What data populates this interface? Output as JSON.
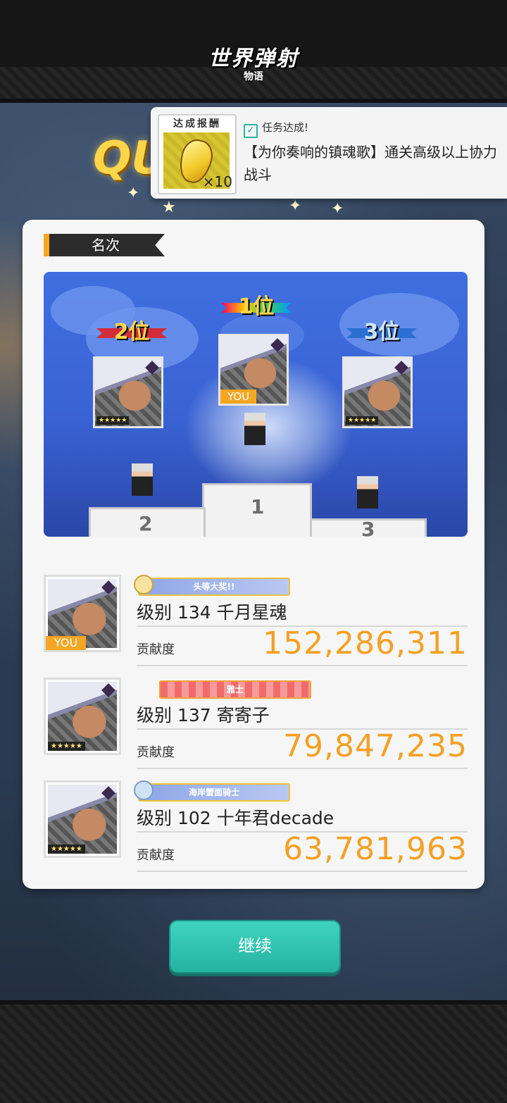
{
  "game": {
    "logo": {
      "main": "世界弹射",
      "sub": "物语"
    },
    "quest_banner_text": "QU"
  },
  "toast": {
    "reward_label": "达成报酬",
    "reward_qty": "×10",
    "reward_icon": "gold-coin-icon",
    "status": "任务达成!",
    "description": "【为你奏响的镇魂歌】通关高级以上协力战斗"
  },
  "ranking": {
    "section_title": "名次",
    "podium": {
      "first_label": "1位",
      "second_label": "2位",
      "third_label": "3位",
      "first_you": "YOU",
      "stage_numbers": [
        "1",
        "2",
        "3"
      ]
    },
    "rows": [
      {
        "badge": "头等大奖!!",
        "name": "级别 134 千月星魂",
        "label": "贡献度",
        "value": "152,286,311",
        "you": "YOU",
        "stars": "★★★★★"
      },
      {
        "badge": "雅士",
        "name": "级别 137 寄寄子",
        "label": "贡献度",
        "value": "79,847,235",
        "stars": "★★★★★"
      },
      {
        "badge": "海岸蟹面骑士",
        "name": "级别 102 十年君decade",
        "label": "贡献度",
        "value": "63,781,963",
        "stars": "★★★★★"
      }
    ]
  },
  "actions": {
    "continue_label": "继续"
  },
  "colors": {
    "accent": "#f5a024",
    "button": "#2bc2ae",
    "podium_bg": "#3a62d4"
  }
}
